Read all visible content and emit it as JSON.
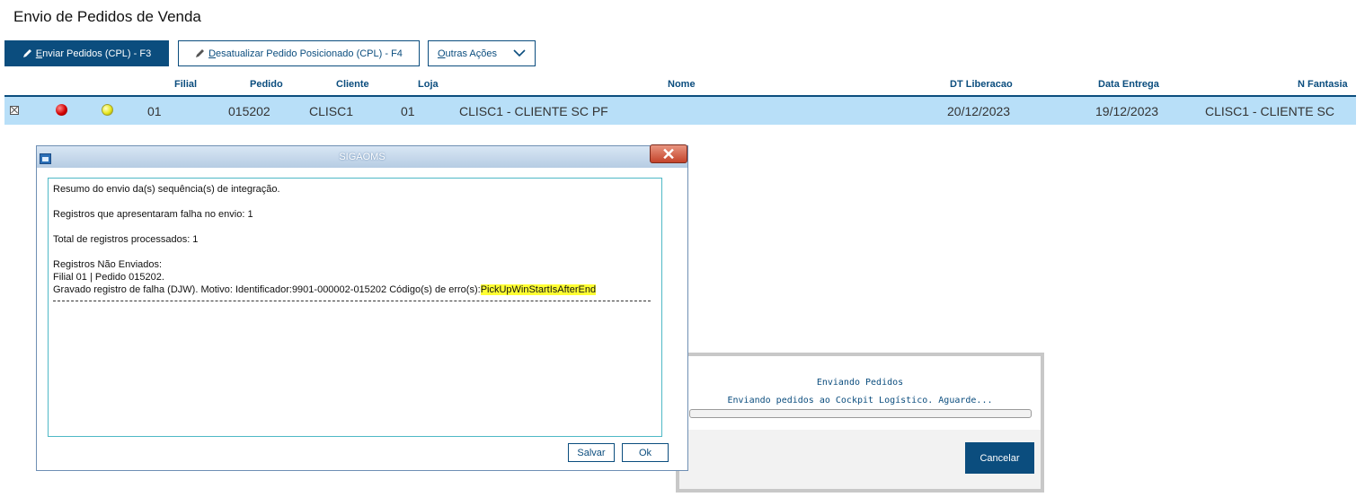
{
  "page": {
    "title": "Envio de Pedidos de Venda"
  },
  "toolbar": {
    "enviar": {
      "icon": "pencil-icon",
      "label_underlined": "E",
      "label_rest": "nviar Pedidos (CPL) - F3"
    },
    "desatualizar": {
      "icon": "pencil-icon",
      "label_underlined": "D",
      "label_rest": "esatualizar Pedido Posicionado (CPL) - F4"
    },
    "outras": {
      "label_underlined": "O",
      "label_rest": "utras Ações",
      "icon": "chevron-down-icon"
    }
  },
  "grid": {
    "columns": [
      "Filial",
      "Pedido",
      "Cliente",
      "Loja",
      "Nome",
      "DT Liberacao",
      "Data Entrega",
      "N Fantasia"
    ],
    "rows": [
      {
        "status_icons": [
          "red-status-icon",
          "yellow-status-icon"
        ],
        "filial": "01",
        "pedido": "015202",
        "cliente": "CLISC1",
        "loja": "01",
        "nome": "CLISC1 - CLIENTE SC PF",
        "dt_liberacao": "20/12/2023",
        "data_entrega": "19/12/2023",
        "n_fantasia": "CLISC1 - CLIENTE SC"
      }
    ]
  },
  "dialog": {
    "title": "SIGAOMS",
    "close_glyph": "✕",
    "lines": {
      "l1": "Resumo do envio da(s) sequência(s) de integração.",
      "l2": "Registros que apresentaram falha no envio: 1",
      "l3": "Total de registros processados: 1",
      "l4": "Registros Não Enviados:",
      "l5": "Filial 01 | Pedido 015202.",
      "l6_prefix": "Gravado registro de falha (DJW). Motivo: Identificador:9901-000002-015202 Código(s) de erro(s):",
      "l6_highlight": "PickUpWinStartIsAfterEnd"
    },
    "buttons": {
      "salvar": "Salvar",
      "ok": "Ok"
    }
  },
  "progress": {
    "title": "Enviando Pedidos",
    "message": "Enviando pedidos ao Cockpit Logístico. Aguarde...",
    "value": 0,
    "cancel": "Cancelar"
  },
  "colors": {
    "accent": "#0b4d7e",
    "row_selected": "#b8dff8",
    "highlight": "#ffff33",
    "status_red": "#d00000",
    "status_yellow": "#e8e820"
  }
}
